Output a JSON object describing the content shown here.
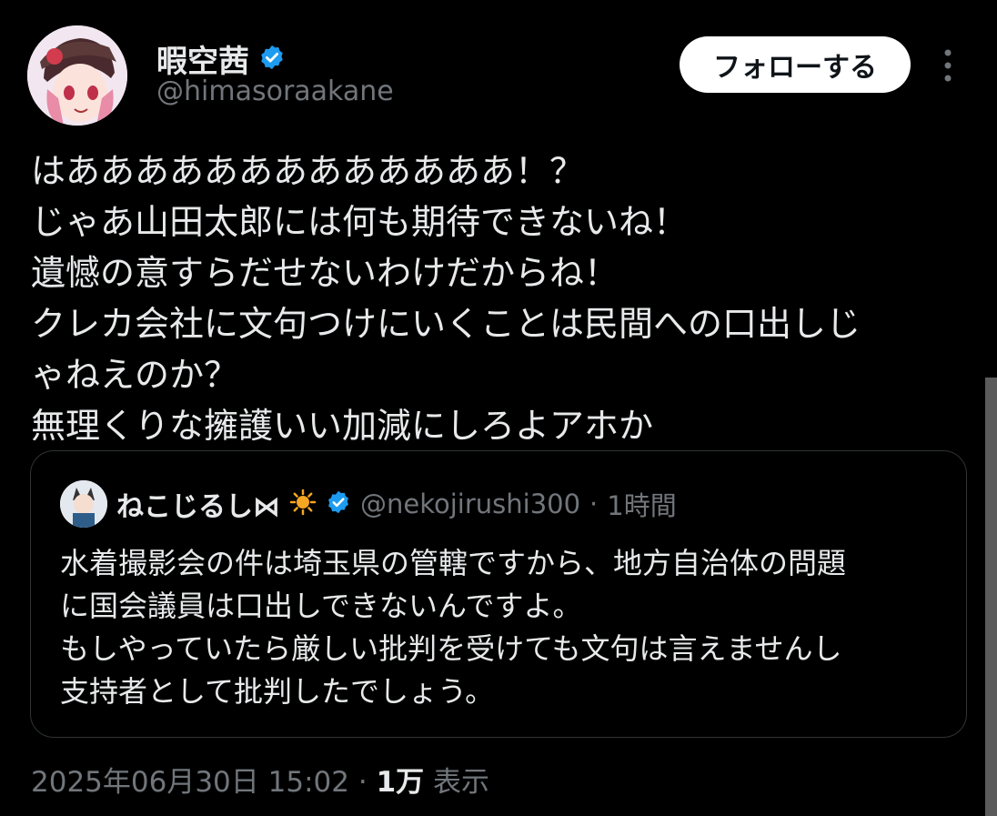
{
  "author": {
    "name": "暇空茜",
    "handle": "@himasoraakane",
    "verified_color": "#1d9bf0"
  },
  "follow_button": {
    "label": "フォローする"
  },
  "tweet_lines": [
    "はあああああああああああああ！？",
    "じゃあ山田太郎には何も期待できないね！",
    "遺憾の意すらだせないわけだからね！",
    "クレカ会社に文句つけにいくことは民間への口出しじ",
    "ゃねえのか？",
    "無理くりな擁護いい加減にしろよアホか"
  ],
  "quote": {
    "name": "ねこじるし⋈",
    "handle": "@nekojirushi300",
    "separator": "·",
    "time": "1時間",
    "lines": [
      "水着撮影会の件は埼玉県の管轄ですから、地方自治体の問題",
      "に国会議員は口出しできないんですよ。",
      "もしやっていたら厳しい批判を受けても文句は言えませんし",
      "支持者として批判したでしょう。"
    ]
  },
  "footer": {
    "timestamp": "2025年06月30日 15:02",
    "separator": "·",
    "views": "1万",
    "views_label": "表示"
  }
}
